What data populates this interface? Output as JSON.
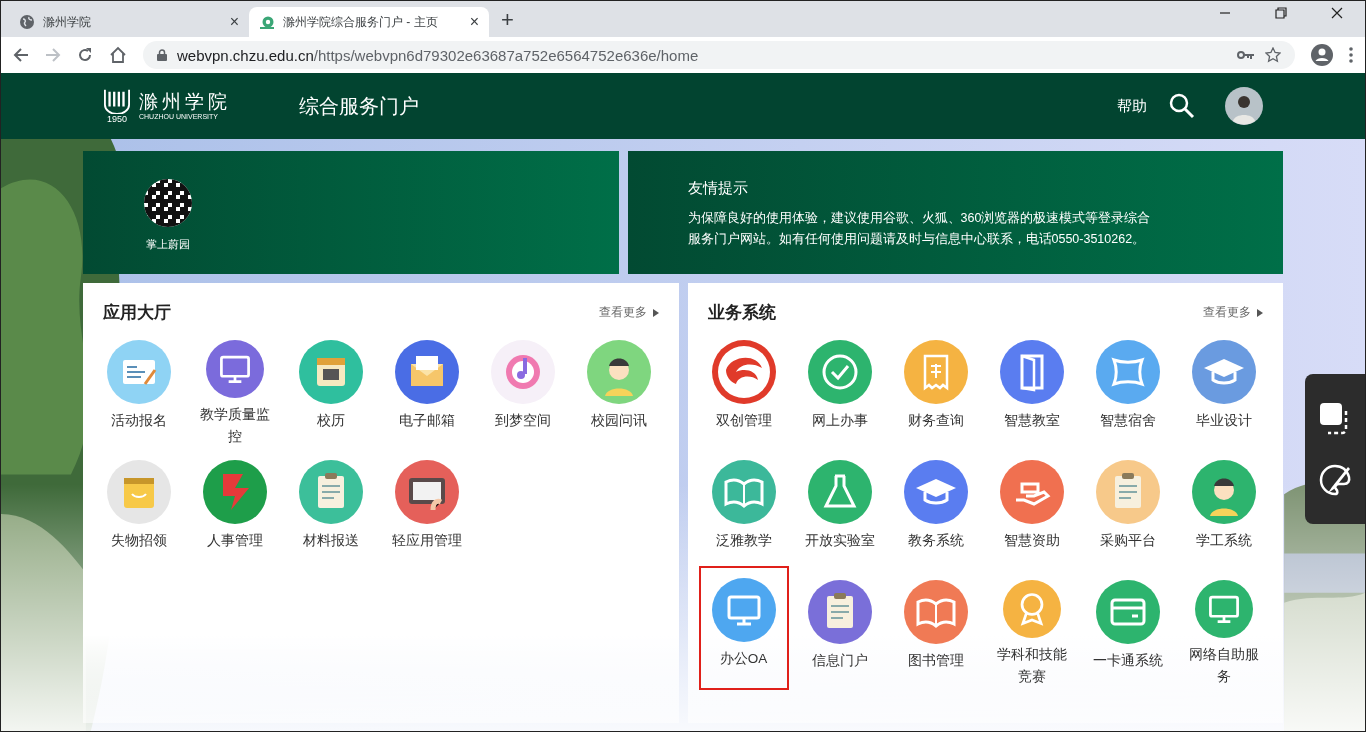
{
  "browser": {
    "tabs": [
      {
        "title": "滁州学院",
        "selected": false,
        "close": "×"
      },
      {
        "title": "滁州学院综合服务门户 - 主页",
        "selected": true,
        "close": "×"
      }
    ],
    "new_tab": "+",
    "address": {
      "host": "webvpn.chzu.edu.cn",
      "path": "/https/webvpn6d79302e63687a752e6564752e636e/home"
    }
  },
  "header": {
    "logo_name": "滁州学院",
    "logo_sub": "CHUZHOU UNIVERSITY",
    "logo_year": "1950",
    "title": "综合服务门户",
    "help": "帮助"
  },
  "banners": {
    "qr_label": "掌上蔚园",
    "notice_title": "友情提示",
    "notice_text": "为保障良好的使用体验，建议使用谷歌、火狐、360浏览器的极速模式等登录综合服务门户网站。如有任何使用问题请及时与信息中心联系，电话0550-3510262。"
  },
  "panels": [
    {
      "title": "应用大厅",
      "more": "查看更多",
      "apps": [
        {
          "label": "活动报名",
          "color": "#8fd3f4",
          "selected": false
        },
        {
          "label": "教学质量监控",
          "color": "#7b6bdc",
          "selected": false
        },
        {
          "label": "校历",
          "color": "#2fbf9e",
          "selected": false
        },
        {
          "label": "电子邮箱",
          "color": "#4a6de5",
          "selected": false
        },
        {
          "label": "到梦空间",
          "color": "#f6f0f8",
          "selected": false
        },
        {
          "label": "校园问讯",
          "color": "#7fd67f",
          "selected": false
        },
        {
          "label": "失物招领",
          "color": "#e6e6e6",
          "selected": false
        },
        {
          "label": "人事管理",
          "color": "#1e9e4a",
          "selected": false
        },
        {
          "label": "材料报送",
          "color": "#3cbf9a",
          "selected": false
        },
        {
          "label": "轻应用管理",
          "color": "#e5605a",
          "selected": false
        }
      ]
    },
    {
      "title": "业务系统",
      "more": "查看更多",
      "apps": [
        {
          "label": "双创管理",
          "color": "#e03a2a",
          "selected": false
        },
        {
          "label": "网上办事",
          "color": "#2db46e",
          "selected": false
        },
        {
          "label": "财务查询",
          "color": "#f5b342",
          "selected": false
        },
        {
          "label": "智慧教室",
          "color": "#5a7df0",
          "selected": false
        },
        {
          "label": "智慧宿舍",
          "color": "#5aaaf0",
          "selected": false
        },
        {
          "label": "毕业设计",
          "color": "#6a9be0",
          "selected": false
        },
        {
          "label": "泛雅教学",
          "color": "#3cb89a",
          "selected": false
        },
        {
          "label": "开放实验室",
          "color": "#2db46e",
          "selected": false
        },
        {
          "label": "教务系统",
          "color": "#5a7df0",
          "selected": false
        },
        {
          "label": "智慧资助",
          "color": "#f07050",
          "selected": false
        },
        {
          "label": "采购平台",
          "color": "#f7c98a",
          "selected": false
        },
        {
          "label": "学工系统",
          "color": "#2db46e",
          "selected": false
        },
        {
          "label": "办公OA",
          "color": "#4ea7f0",
          "selected": true
        },
        {
          "label": "信息门户",
          "color": "#7a6fd9",
          "selected": false
        },
        {
          "label": "图书管理",
          "color": "#f07a55",
          "selected": false
        },
        {
          "label": "学科和技能竞赛",
          "color": "#f5b342",
          "selected": false
        },
        {
          "label": "一卡通系统",
          "color": "#2db46e",
          "selected": false
        },
        {
          "label": "网络自助服务",
          "color": "#2db46e",
          "selected": false
        }
      ]
    }
  ]
}
